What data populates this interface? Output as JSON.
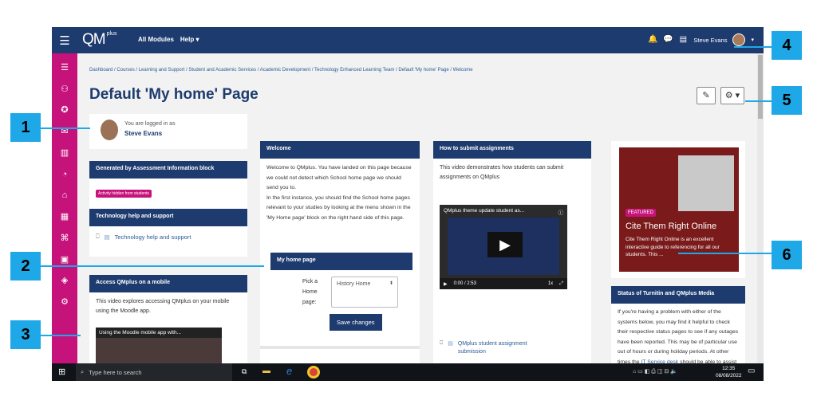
{
  "topbar": {
    "menu_icon": "hamburger-icon",
    "logo": "QM",
    "logo_sub": "plus",
    "nav": [
      "All Modules",
      "Help ▾"
    ],
    "user": "Steve Evans",
    "icons": [
      "bell-icon",
      "chat-icon",
      "document-icon"
    ]
  },
  "sidebar": {
    "icons": [
      "list-icon",
      "group-icon",
      "award-icon",
      "mail-icon",
      "book-icon",
      "speed-icon",
      "home-icon",
      "calendar-icon",
      "graduation-icon",
      "folder-icon",
      "cube-icon",
      "gear-icon"
    ]
  },
  "breadcrumb": "Dashboard / Courses / Learning and Support / Student and Academic Services / Academic Development / Technology Enhanced Learning Team / Default 'My home' Page / Welcome",
  "page_title": "Default 'My home' Page",
  "toolbar": {
    "edit": "✎",
    "settings": "⚙ ▾"
  },
  "left_col": {
    "logged_in_label": "You are logged in as",
    "logged_in_user": "Steve Evans",
    "assessment_title": "Generated by Assessment Information block",
    "assessment_badge": "Activity hidden from students",
    "tech_title": "Technology help and support",
    "tech_link": "Technology help and support",
    "mobile_title": "Access QMplus on a mobile",
    "mobile_text": "This video explores accessing QMplus on your mobile using the Moodle app.",
    "mobile_video": "Using the Moodle mobile app with..."
  },
  "welcome": {
    "title": "Welcome",
    "text": "Welcome to QMplus. You have landed on this page because we could not detect which School home page we should send you to.\nIn the first instance, you should find the School home pages relevant to your studies by looking at the menu shown in the 'My Home page' block on the right hand side of this page.",
    "myhome_title": "My home page",
    "pick_label": "Pick a Home page:",
    "select_value": "History Home",
    "save_button": "Save changes"
  },
  "assignments": {
    "title": "How to submit assignments",
    "text": "This video demonstrates how students can submit assignments on QMplus",
    "video_title": "QMplus theme update student as...",
    "time": "0:00 / 2:53",
    "speed": "1x",
    "link": "QMplus student assignment submission"
  },
  "right_col": {
    "featured_badge": "FEATURED",
    "featured_title": "Cite Them Right Online",
    "featured_text": "Cite Them Right Online is an excellent interactive guide to referencing for all our students. This ...",
    "status_title": "Status of Turnitin and QMplus Media",
    "status_text": "If you're having a problem with either of the systems below, you may find it helpful to check their respective status pages to see if any outages have been reported. This may be of particular use out of hours or during holiday periods. At other times the",
    "status_link": "IT Service desk",
    "status_tail": " should be able to assist"
  },
  "taskbar": {
    "search": "Type here to search",
    "time": "12:35",
    "date": "08/08/2022"
  },
  "callouts": [
    "1",
    "2",
    "3",
    "4",
    "5",
    "6"
  ],
  "colors": {
    "navy": "#1d3b6e",
    "magenta": "#c6137c",
    "callout": "#1ea8e8"
  }
}
